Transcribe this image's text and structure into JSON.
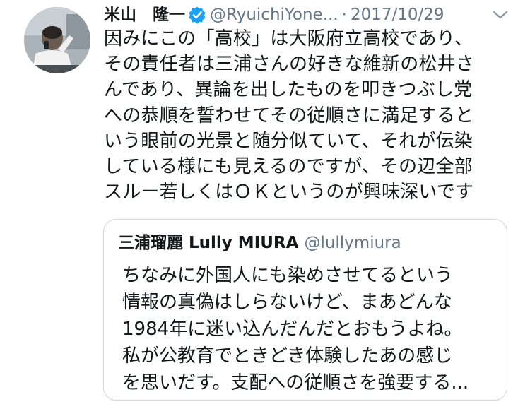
{
  "tweet": {
    "display_name": "米山　隆一",
    "handle": "@RyuichiYone...",
    "separator": "·",
    "date": "2017/10/29",
    "text": "因みにこの「高校」は大阪府立高校であり、\nその責任者は三浦さんの好きな維新の松井さ\nんであり、異論を出したものを叩きつぶし党\nへの恭順を誓わせてその従順さに満足すると\nいう眼前の光景と随分似ていて、それが伝染\nしている様にも見えるのですが、その辺全部\nスルー若しくはＯＫというのが興味深いです",
    "verified": true
  },
  "quoted_tweet": {
    "display_name": "三浦瑠麗 Lully MIURA",
    "handle": "@lullymiura",
    "text": "ちなみに外国人にも染めさせてるという\n情報の真偽はしらないけど、まあどんな\n1984年に迷い込んだんだとおもうよね。\n私が公教育でときどき体験したあの感じ\nを思いだす。支配への従順さを強要する..."
  },
  "icons": {
    "verified": "verified-badge-icon",
    "menu": "chevron-down-icon"
  },
  "colors": {
    "text": "#14171a",
    "secondary_text": "#657786",
    "verified_blue": "#1da1f2",
    "border": "#cfd9de"
  }
}
